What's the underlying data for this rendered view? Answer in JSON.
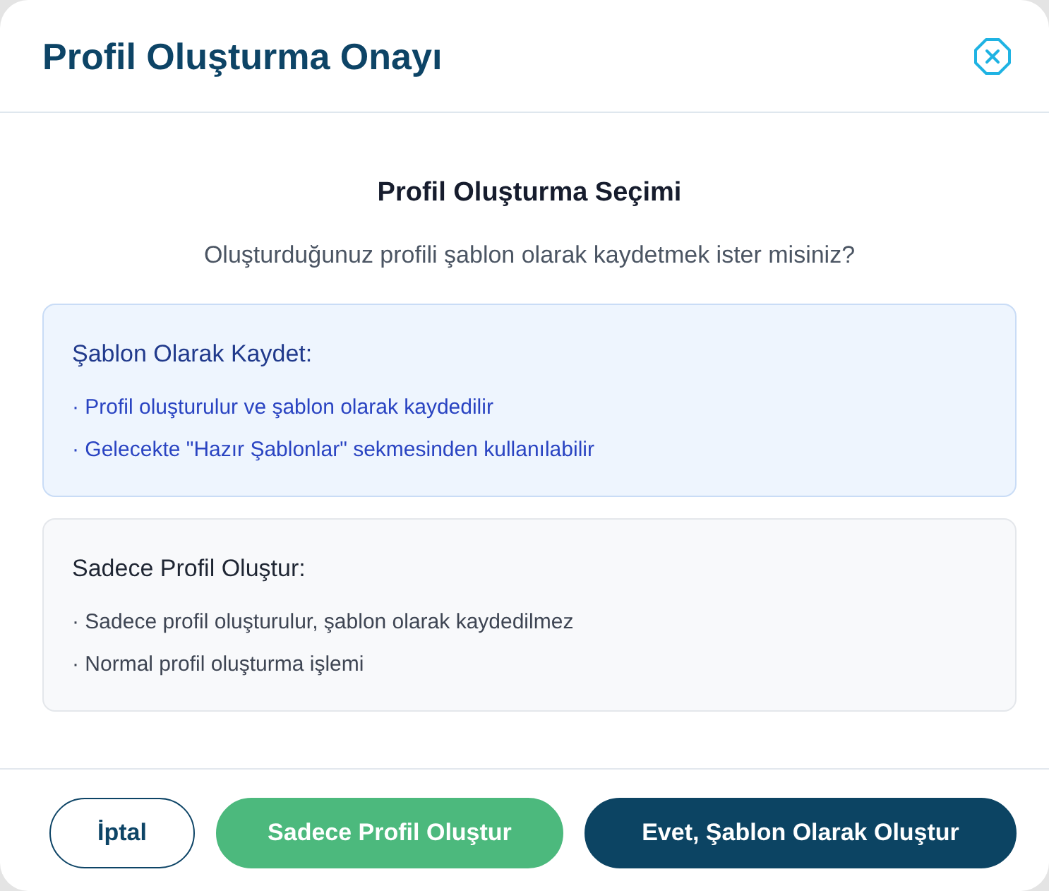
{
  "dialog": {
    "title": "Profil Oluşturma Onayı"
  },
  "body": {
    "heading": "Profil Oluşturma Seçimi",
    "question": "Oluşturduğunuz profili şablon olarak kaydetmek ister misiniz?"
  },
  "options": [
    {
      "kind": "info",
      "title": "Şablon Olarak Kaydet:",
      "points": [
        "· Profil oluşturulur ve şablon olarak kaydedilir",
        "· Gelecekte \"Hazır Şablonlar\" sekmesinden kullanılabilir"
      ]
    },
    {
      "kind": "neutral",
      "title": "Sadece Profil Oluştur:",
      "points": [
        "· Sadece profil oluşturulur, şablon olarak kaydedilmez",
        "· Normal profil oluşturma işlemi"
      ]
    }
  ],
  "buttons": [
    {
      "kind": "outline",
      "label": "İptal"
    },
    {
      "kind": "success",
      "label": "Sadece Profil Oluştur"
    },
    {
      "kind": "primary",
      "label": "Evet, Şablon Olarak Oluştur"
    }
  ]
}
